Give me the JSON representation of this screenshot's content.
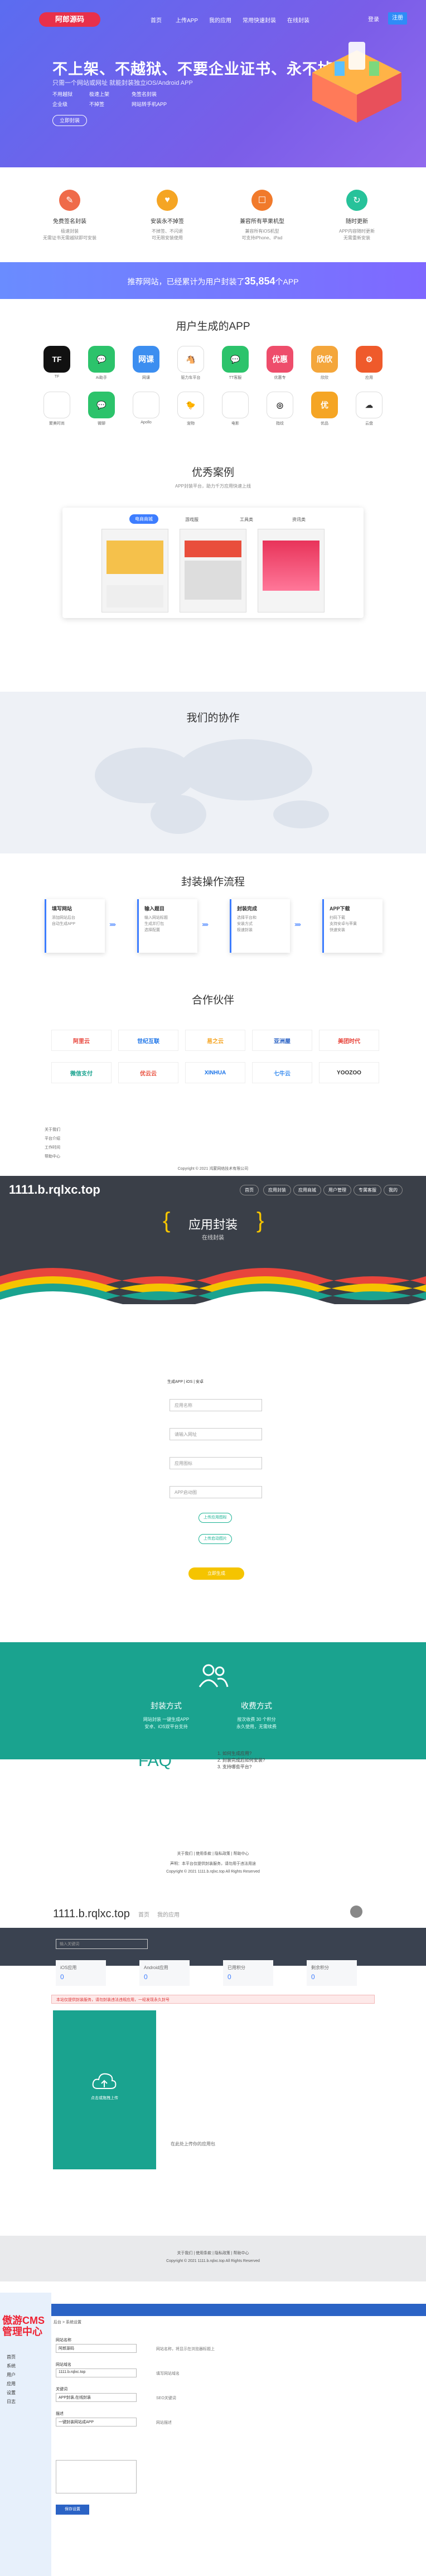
{
  "nav": {
    "logo": "阿郎源码",
    "items": [
      "首页",
      "上传APP",
      "我的应用",
      "常用快速封装",
      "在线封装"
    ],
    "login": "登录",
    "register": "注册"
  },
  "hero": {
    "title": "不上架、不越狱、不要企业证书、永不掉签",
    "subtitle": "只需一个网站或网址 就能封装独立iOS/Android APP",
    "features": [
      "不用越狱",
      "极速上架",
      "免签名封装",
      "企业级",
      "不掉签",
      "网站转手机APP"
    ],
    "cta": "立即封装"
  },
  "features": [
    {
      "title": "免费签名封装",
      "desc": "极速封装\n无需证书无需越狱即可安装",
      "color": "#ef6b4a",
      "icon": "✎"
    },
    {
      "title": "安装永不掉签",
      "desc": "不掉签、不闪退\n可无限安装使用",
      "color": "#f5a524",
      "icon": "♥"
    },
    {
      "title": "兼容所有苹果机型",
      "desc": "兼容所有iOS机型\n可支持iPhone、iPad",
      "color": "#f17a2b",
      "icon": "☐"
    },
    {
      "title": "随时更新",
      "desc": "APP内容随时更新\n无需重新安装",
      "color": "#27c29a",
      "icon": "↻"
    }
  ],
  "banner": {
    "prefix": "推荐网站，已经累计为用户封装了",
    "count": "35,854",
    "suffix": "个APP"
  },
  "apps": {
    "title": "用户生成的APP",
    "items": [
      {
        "label": "TF",
        "name": "TF",
        "color": "#111"
      },
      {
        "label": "💬",
        "name": "Ai助手",
        "color": "#2cc36b"
      },
      {
        "label": "网课",
        "name": "网课",
        "color": "#3c8ef0"
      },
      {
        "label": "🐴",
        "name": "驱力车平台",
        "color": "#fff"
      },
      {
        "label": "💬",
        "name": "TT客服",
        "color": "#2cc36b"
      },
      {
        "label": "优惠",
        "name": "优惠专",
        "color": "#ee4d6b"
      },
      {
        "label": "欣欣",
        "name": "欣欣",
        "color": "#f4a63b"
      },
      {
        "label": "⚙",
        "name": "应用",
        "color": "#ef5a2b"
      },
      {
        "label": "",
        "name": "聚美时尚",
        "color": "#fff"
      },
      {
        "label": "💬",
        "name": "微聊",
        "color": "#2cc36b"
      },
      {
        "label": "",
        "name": "Apollo",
        "color": "#fff"
      },
      {
        "label": "🐤",
        "name": "宠物",
        "color": "#fff"
      },
      {
        "label": "",
        "name": "电影",
        "color": "#fff"
      },
      {
        "label": "◎",
        "name": "指纹",
        "color": "#fff"
      },
      {
        "label": "优",
        "name": "优品",
        "color": "#f5a524"
      },
      {
        "label": "☁",
        "name": "云盘",
        "color": "#fff"
      }
    ]
  },
  "cases": {
    "title": "优秀案例",
    "subtitle": "APP封装平台，助力千万应用快速上线",
    "tabs": [
      "电商商城",
      "游戏服",
      "工具类",
      "资讯类"
    ]
  },
  "map": {
    "title": "我们的协作"
  },
  "flow": {
    "title": "封装操作流程",
    "steps": [
      {
        "t": "填写网站",
        "d": "添加网站后台\n自动生成APP"
      },
      {
        "t": "输入题目",
        "d": "输入网站标题\n生成并打包\n选择配置"
      },
      {
        "t": "封装完成",
        "d": "选择平台和\n安装方式\n极速封装"
      },
      {
        "t": "APP下载",
        "d": "扫码下载\n支持安卓与苹果\n快速安装"
      }
    ]
  },
  "partners": {
    "title": "合作伙伴",
    "items": [
      "阿里云",
      "世纪互联",
      "易之云",
      "亚洲屋",
      "美团时代",
      "微信支付",
      "优云云",
      "XINHUA",
      "七牛云",
      "YOOZOO"
    ]
  },
  "footer1": {
    "links": [
      "关于我们",
      "平台介绍",
      "工作时间",
      "帮助中心"
    ],
    "copyright": "Copyright © 2021 鸿蒙网络技术有限公司"
  },
  "site": {
    "domain": "1111.b.rqlxc.top",
    "nav": [
      "首页",
      "应用封装",
      "应用商城",
      "用户管理",
      "专属客服",
      "安卓封装",
      "合作伙伴",
      "我的"
    ]
  },
  "pack": {
    "title": "应用封装",
    "subtitle": "在线封装",
    "radio": "生成APP  |  iOS  |  安卓",
    "inputs": [
      "应用名称",
      "请输入网址",
      "应用图标",
      "APP启动图"
    ],
    "btn1": "上传应用图标",
    "btn2": "上传启动图片",
    "submit": "立即生成"
  },
  "method": {
    "col1": {
      "title": "封装方式",
      "desc": "网站封装 一键生成APP\n安卓、iOS双平台支持"
    },
    "col2": {
      "title": "收费方式",
      "desc": "按次收费 30 个积分\n永久使用，无需续费"
    }
  },
  "faq": {
    "title": "FAQ",
    "items": [
      "1. 如何生成应用?",
      "2. 封装完成后如何安装?",
      "3. 支持哪些平台?"
    ]
  },
  "footer2": {
    "links": "关于我们  |  使用条款  |  隐私政策  |  帮助中心",
    "addr": "声明：本平台仅提供封装服务，请勿用于违法用途",
    "copy": "Copyright © 2021 1111.b.rqlxc.top All Rights Reserved"
  },
  "dash": {
    "title": "1111.b.rqlxc.top",
    "tabs": [
      "首页",
      "我的应用"
    ],
    "search": "输入关键词",
    "stats": [
      {
        "l": "iOS应用",
        "v": "0"
      },
      {
        "l": "Android应用",
        "v": "0"
      },
      {
        "l": "已用积分",
        "v": "0"
      },
      {
        "l": "剩余积分",
        "v": "0"
      }
    ],
    "alert": "本站仅提供封装服务，请勿封装违法违规应用，一经发现永久封号",
    "upload": "点击或拖拽上传",
    "uploadHint": "在此处上传你的应用包"
  },
  "admin": {
    "logo": "傲游CMS 管理中心",
    "menu": [
      "首页",
      "系统",
      "用户",
      "应用",
      "设置",
      "日志"
    ],
    "breadcrumb": "后台 > 系统设置",
    "fields": [
      {
        "l": "网站名称",
        "v": "阿郎源码",
        "h": "网站名称，将显示在浏览器标题上"
      },
      {
        "l": "网站域名",
        "v": "1111.b.rqlxc.top",
        "h": "填写网站域名"
      },
      {
        "l": "关键词",
        "v": "APP封装,在线封装",
        "h": "SEO关键词"
      },
      {
        "l": "描述",
        "v": "一键封装网站成APP",
        "h": "网站描述"
      }
    ],
    "save": "保存设置"
  }
}
